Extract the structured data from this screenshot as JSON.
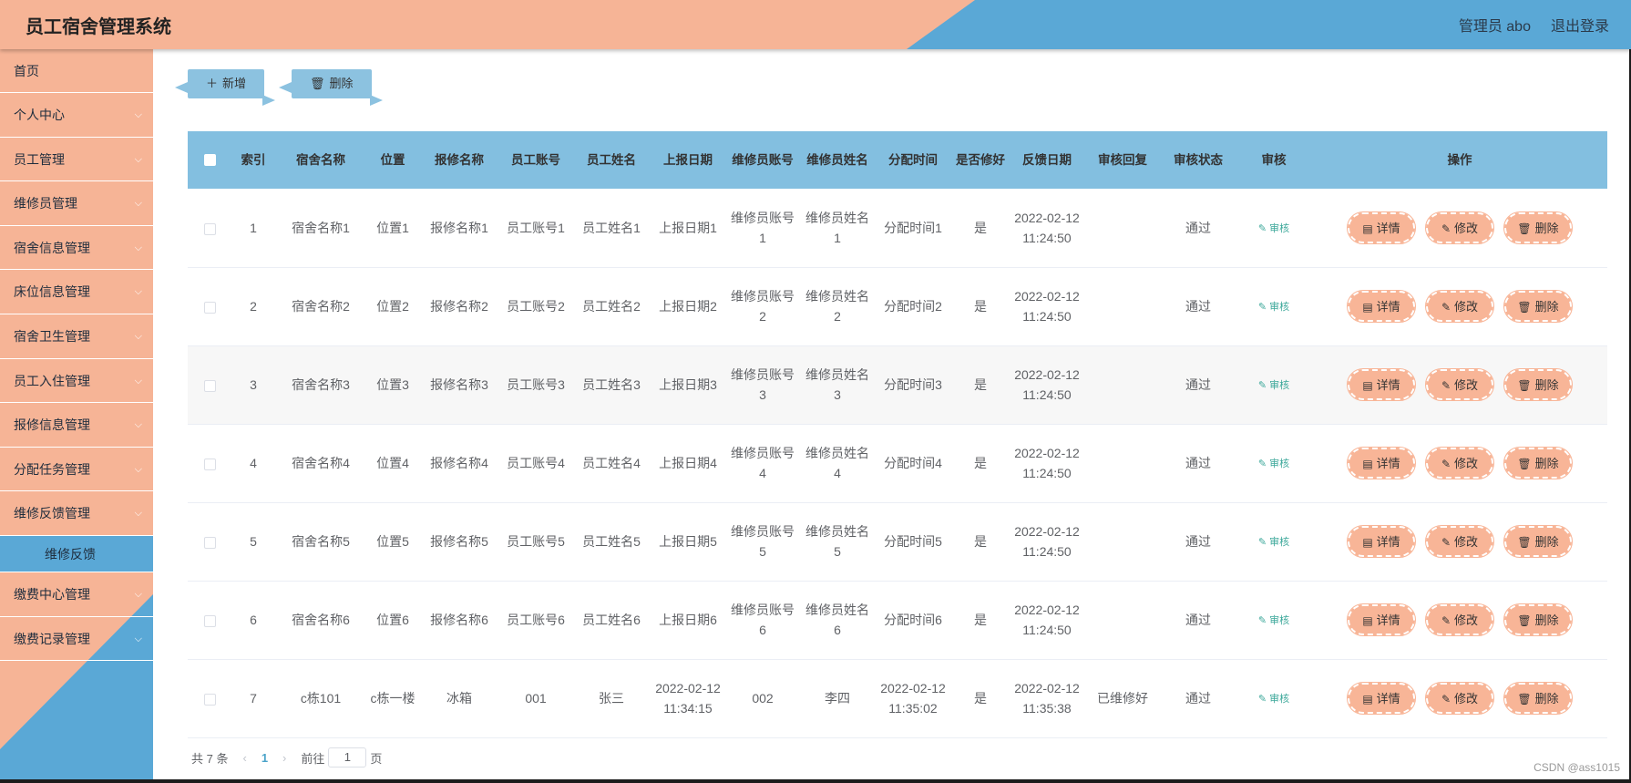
{
  "header": {
    "title": "员工宿舍管理系统",
    "admin_label": "管理员 abo",
    "logout_label": "退出登录",
    "colors": {
      "peach": "#f6b496",
      "blue": "#5aa8d6"
    }
  },
  "sidebar": {
    "items": [
      {
        "label": "首页",
        "has_chevron": false
      },
      {
        "label": "个人中心",
        "has_chevron": true
      },
      {
        "label": "员工管理",
        "has_chevron": true
      },
      {
        "label": "维修员管理",
        "has_chevron": true
      },
      {
        "label": "宿舍信息管理",
        "has_chevron": true
      },
      {
        "label": "床位信息管理",
        "has_chevron": true
      },
      {
        "label": "宿舍卫生管理",
        "has_chevron": true
      },
      {
        "label": "员工入住管理",
        "has_chevron": true
      },
      {
        "label": "报修信息管理",
        "has_chevron": true
      },
      {
        "label": "分配任务管理",
        "has_chevron": true
      },
      {
        "label": "维修反馈管理",
        "has_chevron": true
      },
      {
        "label": "缴费中心管理",
        "has_chevron": true
      },
      {
        "label": "缴费记录管理",
        "has_chevron": true
      }
    ],
    "active_submenu": "维修反馈"
  },
  "toolbar": {
    "add_label": "新增",
    "delete_label": "删除",
    "add_icon": "plus-icon",
    "delete_icon": "trash-icon"
  },
  "table": {
    "columns": [
      "索引",
      "宿舍名称",
      "位置",
      "报修名称",
      "员工账号",
      "员工姓名",
      "上报日期",
      "维修员账号",
      "维修员姓名",
      "分配时间",
      "是否修好",
      "反馈日期",
      "审核回复",
      "审核状态",
      "审核",
      "操作"
    ],
    "audit_label": "审核",
    "detail_label": "详情",
    "edit_label": "修改",
    "delete_label": "删除",
    "rows": [
      {
        "index": "1",
        "dorm": "宿舍名称1",
        "location": "位置1",
        "repair": "报修名称1",
        "account": "员工账号1",
        "name": "员工姓名1",
        "report_date": "上报日期1",
        "worker_account": "维修员账号1",
        "worker_name": "维修员姓名1",
        "assign_time": "分配时间1",
        "fixed": "是",
        "feedback_date": "2022-02-12 11:24:50",
        "reply": "",
        "status": "通过"
      },
      {
        "index": "2",
        "dorm": "宿舍名称2",
        "location": "位置2",
        "repair": "报修名称2",
        "account": "员工账号2",
        "name": "员工姓名2",
        "report_date": "上报日期2",
        "worker_account": "维修员账号2",
        "worker_name": "维修员姓名2",
        "assign_time": "分配时间2",
        "fixed": "是",
        "feedback_date": "2022-02-12 11:24:50",
        "reply": "",
        "status": "通过"
      },
      {
        "index": "3",
        "dorm": "宿舍名称3",
        "location": "位置3",
        "repair": "报修名称3",
        "account": "员工账号3",
        "name": "员工姓名3",
        "report_date": "上报日期3",
        "worker_account": "维修员账号3",
        "worker_name": "维修员姓名3",
        "assign_time": "分配时间3",
        "fixed": "是",
        "feedback_date": "2022-02-12 11:24:50",
        "reply": "",
        "status": "通过"
      },
      {
        "index": "4",
        "dorm": "宿舍名称4",
        "location": "位置4",
        "repair": "报修名称4",
        "account": "员工账号4",
        "name": "员工姓名4",
        "report_date": "上报日期4",
        "worker_account": "维修员账号4",
        "worker_name": "维修员姓名4",
        "assign_time": "分配时间4",
        "fixed": "是",
        "feedback_date": "2022-02-12 11:24:50",
        "reply": "",
        "status": "通过"
      },
      {
        "index": "5",
        "dorm": "宿舍名称5",
        "location": "位置5",
        "repair": "报修名称5",
        "account": "员工账号5",
        "name": "员工姓名5",
        "report_date": "上报日期5",
        "worker_account": "维修员账号5",
        "worker_name": "维修员姓名5",
        "assign_time": "分配时间5",
        "fixed": "是",
        "feedback_date": "2022-02-12 11:24:50",
        "reply": "",
        "status": "通过"
      },
      {
        "index": "6",
        "dorm": "宿舍名称6",
        "location": "位置6",
        "repair": "报修名称6",
        "account": "员工账号6",
        "name": "员工姓名6",
        "report_date": "上报日期6",
        "worker_account": "维修员账号6",
        "worker_name": "维修员姓名6",
        "assign_time": "分配时间6",
        "fixed": "是",
        "feedback_date": "2022-02-12 11:24:50",
        "reply": "",
        "status": "通过"
      },
      {
        "index": "7",
        "dorm": "c栋101",
        "location": "c栋一楼",
        "repair": "冰箱",
        "account": "001",
        "name": "张三",
        "report_date": "2022-02-12 11:34:15",
        "worker_account": "002",
        "worker_name": "李四",
        "assign_time": "2022-02-12 11:35:02",
        "fixed": "是",
        "feedback_date": "2022-02-12 11:35:38",
        "reply": "已维修好",
        "status": "通过"
      }
    ]
  },
  "pagination": {
    "total_label": "共 7 条",
    "current_page": "1",
    "goto_prefix": "前往",
    "goto_value": "1",
    "goto_suffix": "页"
  },
  "watermark": "CSDN @ass1015"
}
